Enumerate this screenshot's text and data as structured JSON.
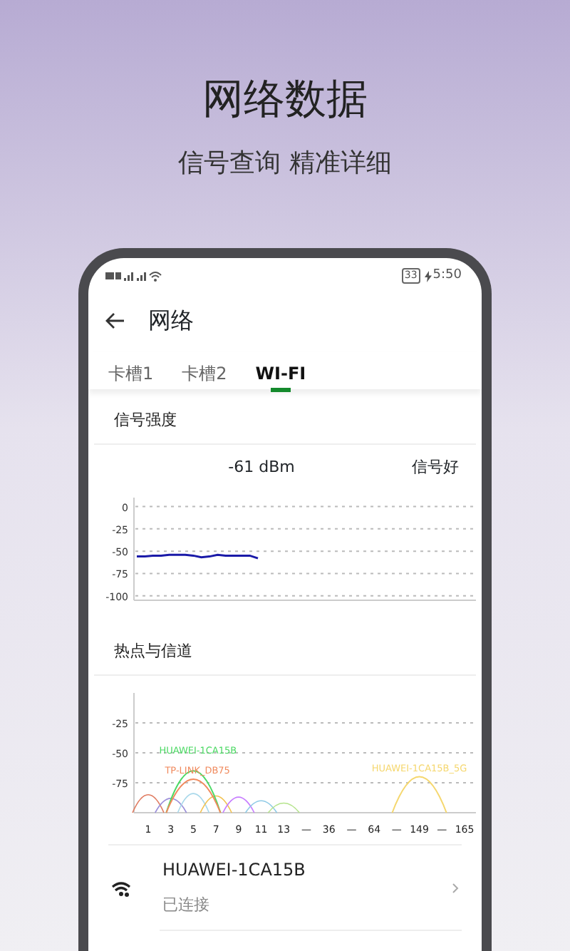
{
  "headline": "网络数据",
  "subheadline": "信号查询 精准详细",
  "status_bar": {
    "battery": "33",
    "time": "5:50"
  },
  "app_bar": {
    "title": "网络"
  },
  "tabs": [
    {
      "label": "卡槽1",
      "selected": false
    },
    {
      "label": "卡槽2",
      "selected": false
    },
    {
      "label": "WI-FI",
      "selected": true
    }
  ],
  "signal_section": {
    "title": "信号强度",
    "reading": "-61  dBm",
    "quality": "信号好",
    "chart_data": {
      "type": "line",
      "grid": true,
      "yticks": [
        0,
        -25,
        -50,
        -75,
        -100
      ],
      "ylim": [
        -105,
        10
      ],
      "series": [
        {
          "color": "#1a1aa8",
          "values": [
            -56,
            -56,
            -55,
            -55,
            -54,
            -54,
            -54,
            -55,
            -57,
            -56,
            -54,
            -55,
            -55,
            -55,
            -55,
            -58,
            null,
            null,
            null,
            null,
            null,
            null,
            null,
            null,
            null,
            null,
            null,
            null,
            null,
            null,
            null,
            null,
            null,
            null,
            null,
            null,
            null,
            null,
            null,
            null,
            null,
            null,
            null
          ]
        }
      ]
    }
  },
  "hotspot_section": {
    "title": "热点与信道",
    "y_tick_labels": [
      "-25",
      "-50",
      "-75"
    ],
    "channel_labels": [
      "1",
      "3",
      "5",
      "7",
      "9",
      "11",
      "13",
      "—",
      "36",
      "—",
      "64",
      "—",
      "149",
      "—",
      "165"
    ],
    "hotspots": [
      {
        "label": "HUAWEI-1CA15B",
        "color": "#4cd964"
      },
      {
        "label": "TP-LINK_DB75",
        "color": "#f08a5d"
      },
      {
        "label": "HUAWEI-1CA15B_5G",
        "color": "#f5d76e"
      }
    ]
  },
  "networks": [
    {
      "name": "HUAWEI-1CA15B",
      "status": "已连接"
    }
  ]
}
